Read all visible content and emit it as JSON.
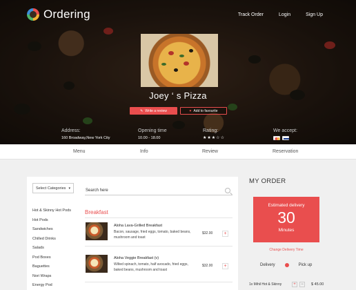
{
  "brand": {
    "name": "Ordering"
  },
  "topnav": {
    "track": "Track Order",
    "login": "Login",
    "signup": "Sign Up"
  },
  "restaurant": {
    "name": "Joey ‘ s Pizza",
    "write_review": "Write a review",
    "add_favourite": "Add to favourite",
    "address_label": "Address:",
    "address": "160 Broadway,New York City",
    "hours_label": "Opening time",
    "hours": "10.00 - 18.00",
    "rating_label": "Rating:",
    "rating": 3,
    "rating_max": 5,
    "accept_label": "We accept:"
  },
  "tabs": [
    "Menu",
    "Info",
    "Review",
    "Reservation"
  ],
  "menu": {
    "category_select": "Select Categories",
    "search_placeholder": "Search here",
    "categories": [
      "Hot & Skinny Hot Pods",
      "Hot Pods",
      "Sandwiches",
      "Chilled Drinks",
      "Salads",
      "Pod Boxes",
      "Baguettes",
      "Nori Wraps",
      "Energy Pod"
    ],
    "section": "Breakfast",
    "items": [
      {
        "name": "Aloha Lava-Grilled Breakfast",
        "desc": "Bacon, sausage, fried eggs, tomato, baked beans, mushroom and toast",
        "price": "$32.00"
      },
      {
        "name": "Aloha Veggie Breakfast (v)",
        "desc": "Wilted spinach, tomato, half avocado, fried eggs, baked beans, mushroom and toast",
        "price": "$32.00"
      }
    ]
  },
  "order": {
    "title": "MY ORDER",
    "est_label": "Estimated delivery",
    "est_value": "30",
    "est_unit": "Minutes",
    "change_time": "Change Delivery Time",
    "delivery": "Delivery",
    "pickup": "Pick up",
    "cart_item": "1x Mihil Hot & Skinny",
    "cart_price": "$ 45.00"
  },
  "colors": {
    "accent": "#e94e4e"
  }
}
